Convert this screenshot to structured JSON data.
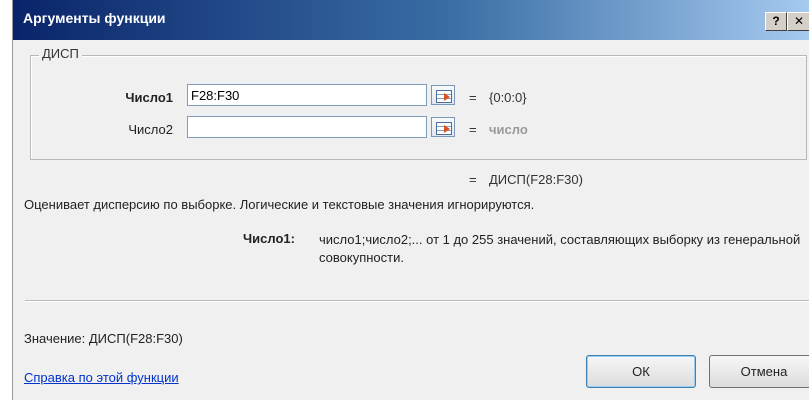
{
  "dialog": {
    "title": "Аргументы функции",
    "help_glyph": "?",
    "close_glyph": "✕"
  },
  "function_group": {
    "name": "ДИСП",
    "args": [
      {
        "label": "Число1",
        "value": "F28:F30",
        "equals": "=",
        "result": "{0:0:0}"
      },
      {
        "label": "Число2",
        "value": "",
        "equals": "=",
        "result": "число"
      }
    ]
  },
  "formula_result": {
    "equals": "=",
    "text": "ДИСП(F28:F30)"
  },
  "description": "Оценивает дисперсию по выборке. Логические и текстовые значения игнорируются.",
  "arg_description": {
    "label": "Число1:",
    "text": "число1;число2;... от 1 до 255 значений, составляющих выборку из генеральной совокупности."
  },
  "value_line": "Значение:  ДИСП(F28:F30)",
  "help_link": "Справка по этой функции",
  "buttons": {
    "ok": "ОК",
    "cancel": "Отмена"
  },
  "colors": {
    "title_gradient_start": "#0a246a",
    "link": "#0033cc",
    "placeholder_result": "#9a9a9a"
  }
}
